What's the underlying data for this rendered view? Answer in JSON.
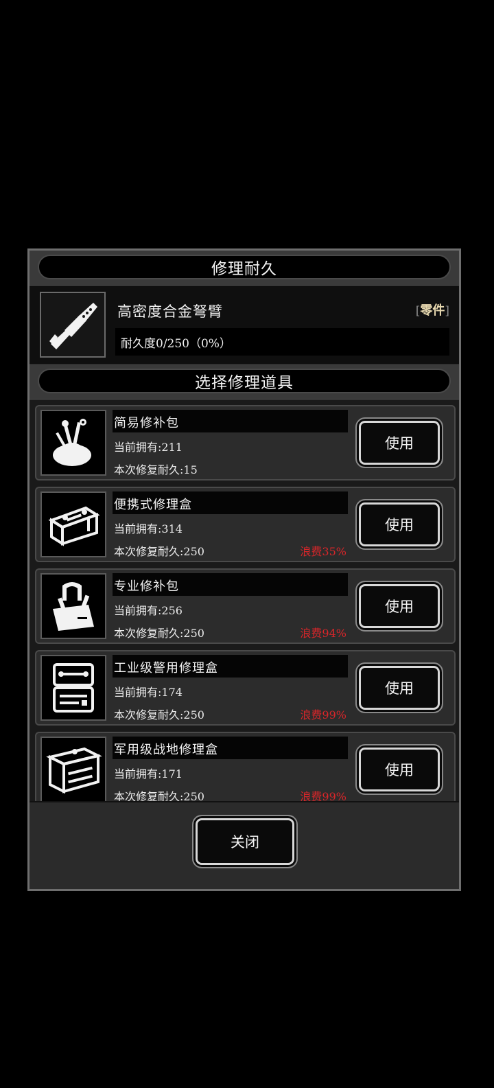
{
  "dialog": {
    "title": "修理耐久",
    "item": {
      "name": "高密度合金弩臂",
      "tag_open": "[",
      "tag": "零件",
      "tag_close": "]",
      "durability_text": "耐久度0/250（0%）",
      "durability_fraction": 0.0,
      "icon": "crossbow-arm-icon"
    },
    "select_title": "选择修理道具",
    "tools": [
      {
        "name": "简易修补包",
        "owned": "当前拥有:211",
        "repair": "本次修复耐久:15",
        "waste": "",
        "button": "使用",
        "icon": "pouch-tools-icon"
      },
      {
        "name": "便携式修理盒",
        "owned": "当前拥有:314",
        "repair": "本次修复耐久:250",
        "waste": "浪费35%",
        "button": "使用",
        "icon": "portable-toolbox-icon"
      },
      {
        "name": "专业修补包",
        "owned": "当前拥有:256",
        "repair": "本次修复耐久:250",
        "waste": "浪费94%",
        "button": "使用",
        "icon": "professional-kit-icon"
      },
      {
        "name": "工业级警用修理盒",
        "owned": "当前拥有:174",
        "repair": "本次修复耐久:250",
        "waste": "浪费99%",
        "button": "使用",
        "icon": "industrial-case-icon"
      },
      {
        "name": "军用级战地修理盒",
        "owned": "当前拥有:171",
        "repair": "本次修复耐久:250",
        "waste": "浪费99%",
        "button": "使用",
        "icon": "military-toolbox-icon"
      }
    ],
    "close_label": "关闭"
  },
  "colors": {
    "waste": "#d8262a",
    "tag": "#e8d9b0",
    "panel": "#2b2b2b"
  }
}
